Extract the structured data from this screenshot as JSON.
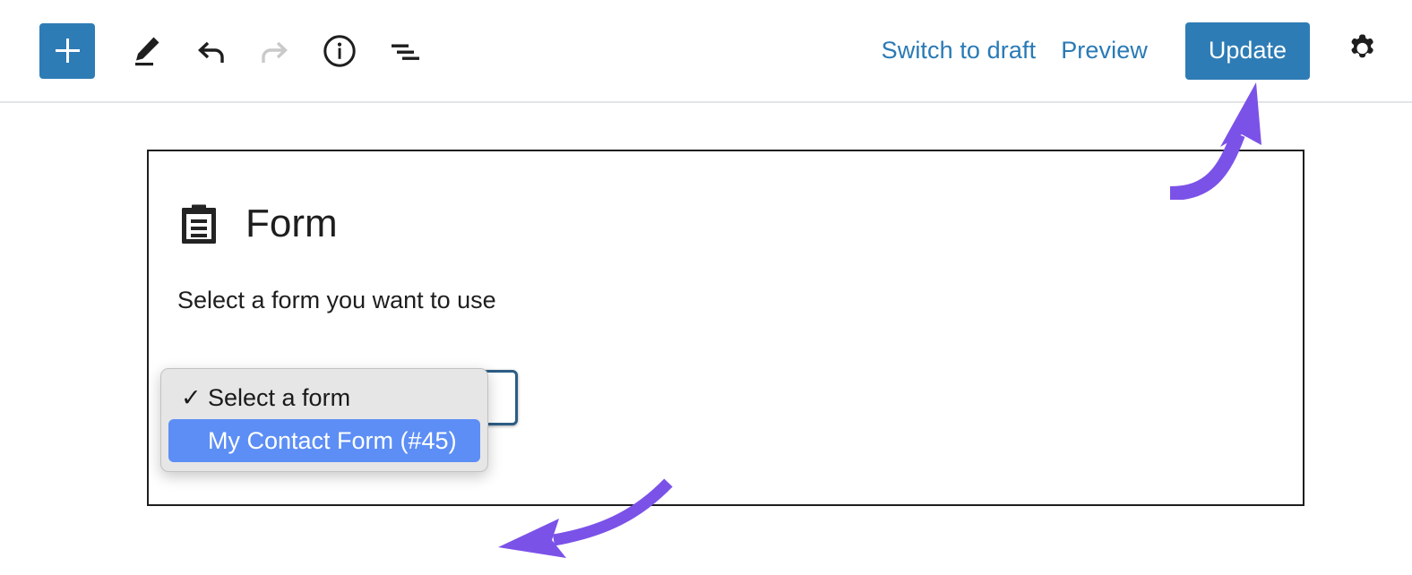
{
  "app": {
    "name": "WordPress Block Editor",
    "accent_blue": "#2e7cb5",
    "link_blue": "#2a7ab5",
    "annotation_purple": "#7b52e8",
    "selection_blue": "#5c8ef5",
    "block_border": "#1e1e1e"
  },
  "toolbar": {
    "add_block": {
      "label": "+",
      "icon": "plus-icon",
      "tooltip": "Add block"
    },
    "tools": [
      {
        "id": "edit",
        "icon": "pencil-icon",
        "label": "Edit",
        "disabled": false
      },
      {
        "id": "undo",
        "icon": "undo-arrow-icon",
        "label": "Undo",
        "disabled": false
      },
      {
        "id": "redo",
        "icon": "redo-arrow-icon",
        "label": "Redo",
        "disabled": true
      },
      {
        "id": "details",
        "icon": "info-circle-icon",
        "label": "Details",
        "disabled": false
      },
      {
        "id": "list-view",
        "icon": "list-view-icon",
        "label": "List view",
        "disabled": false
      }
    ],
    "switch_to_draft_label": "Switch to draft",
    "preview_label": "Preview",
    "update_label": "Update",
    "settings": {
      "icon": "gear-icon",
      "label": "Settings"
    }
  },
  "block": {
    "title": "Form",
    "icon": "clipboard-form-icon",
    "help_text": "Select a form you want to use",
    "select": {
      "value": "Select a form",
      "focused": true,
      "expanded": true
    }
  },
  "dropdown": {
    "items": [
      {
        "label": "Select a form",
        "checked": true,
        "highlighted": false
      },
      {
        "label": "My Contact Form (#45)",
        "checked": false,
        "highlighted": true
      }
    ],
    "check_glyph": "✓"
  },
  "annotations": [
    {
      "id": "arrow-to-update",
      "target": "update-button",
      "color": "#7b52e8",
      "direction": "up"
    },
    {
      "id": "arrow-to-dropdown",
      "target": "dropdown-menu",
      "color": "#7b52e8",
      "direction": "left"
    }
  ]
}
